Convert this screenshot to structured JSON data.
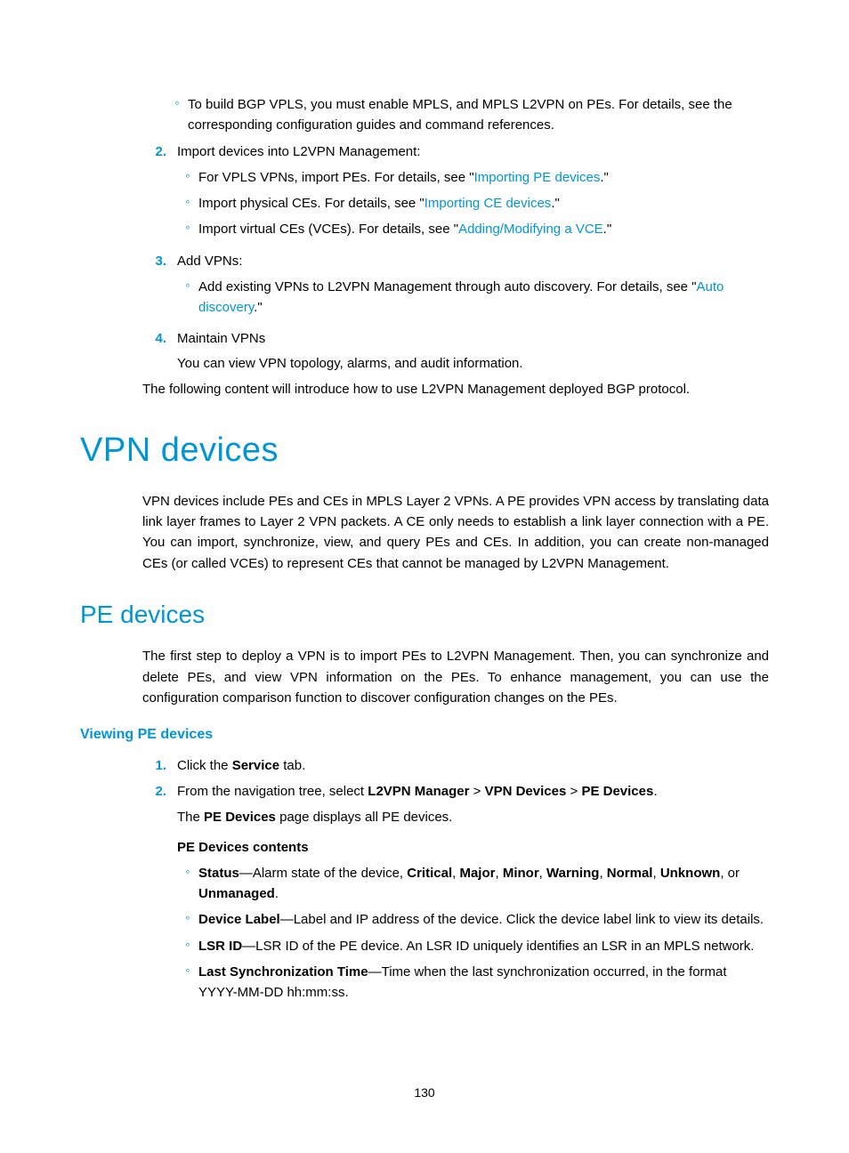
{
  "step1_bullet": "To build BGP VPLS, you must enable MPLS, and MPLS L2VPN on PEs. For details, see the corresponding configuration guides and command references.",
  "step2": {
    "num": "2.",
    "title": "Import devices into L2VPN Management:",
    "b1_pre": "For VPLS VPNs, import PEs. For details, see \"",
    "b1_link": "Importing PE devices",
    "b1_post": ".\"",
    "b2_pre": "Import physical CEs. For details, see \"",
    "b2_link": "Importing CE devices",
    "b2_post": ".\"",
    "b3_pre": "Import virtual CEs (VCEs). For details, see \"",
    "b3_link": "Adding/Modifying a VCE",
    "b3_post": ".\""
  },
  "step3": {
    "num": "3.",
    "title": "Add VPNs:",
    "b1_pre": "Add existing VPNs to L2VPN Management through auto discovery. For details, see \"",
    "b1_link": "Auto discovery",
    "b1_post": ".\""
  },
  "step4": {
    "num": "4.",
    "title": "Maintain VPNs",
    "desc": "You can view VPN topology, alarms, and audit information."
  },
  "closing": "The following content will introduce how to use L2VPN Management deployed BGP protocol.",
  "h_vpn": "VPN devices",
  "vpn_para": "VPN devices include PEs and CEs in MPLS Layer 2 VPNs. A PE provides VPN access by translating data link layer frames to Layer 2 VPN packets. A CE only needs to establish a link layer connection with a PE. You can import, synchronize, view, and query PEs and CEs. In addition, you can create non-managed CEs (or called VCEs) to represent CEs that cannot be managed by L2VPN Management.",
  "h_pe": "PE devices",
  "pe_para": "The first step to deploy a VPN is to import PEs to L2VPN Management. Then, you can synchronize and delete PEs, and view VPN information on the PEs. To enhance management, you can use the configuration comparison function to discover configuration changes on the PEs.",
  "h_view": "Viewing PE devices",
  "view": {
    "s1_num": "1.",
    "s1_pre": "Click the ",
    "s1_bold": "Service",
    "s1_post": " tab.",
    "s2_num": "2.",
    "s2_pre": "From the navigation tree, select ",
    "s2_b1": "L2VPN Manager",
    "s2_gt1": " > ",
    "s2_b2": "VPN Devices",
    "s2_gt2": " > ",
    "s2_b3": "PE Devices",
    "s2_post": ".",
    "s2_desc_pre": "The ",
    "s2_desc_b": "PE Devices",
    "s2_desc_post": " page displays all PE devices.",
    "contents_title": "PE Devices contents",
    "c1_b": "Status",
    "c1_mid": "—Alarm state of the device, ",
    "c1_v1": "Critical",
    "c1_c1": ", ",
    "c1_v2": "Major",
    "c1_c2": ", ",
    "c1_v3": "Minor",
    "c1_c3": ", ",
    "c1_v4": "Warning",
    "c1_c4": ", ",
    "c1_v5": "Normal",
    "c1_c5": ", ",
    "c1_v6": "Unknown",
    "c1_c6": ", or ",
    "c1_v7": "Unmanaged",
    "c1_end": ".",
    "c2_b": "Device Label",
    "c2_rest": "—Label and IP address of the device. Click the device label link to view its details.",
    "c3_b": "LSR ID",
    "c3_rest": "—LSR ID of the PE device. An LSR ID uniquely identifies an LSR in an MPLS network.",
    "c4_b": "Last Synchronization Time",
    "c4_rest": "—Time when the last synchronization occurred, in the format YYYY-MM-DD hh:mm:ss."
  },
  "pagenum": "130",
  "circ": "∘"
}
